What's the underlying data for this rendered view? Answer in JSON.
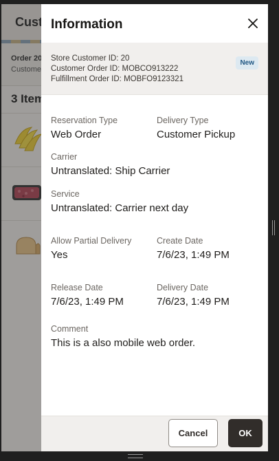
{
  "background": {
    "title": "Cust",
    "order_id": "Order 20",
    "order_sub": "Custome",
    "items_title": "3 Item"
  },
  "drawer": {
    "title": "Information",
    "summary": {
      "store_customer_id": "Store Customer ID: 20",
      "customer_order_id": "Customer Order ID: MOBCO913222",
      "fulfillment_order_id": "Fulfillment Order ID: MOBFO9123321",
      "badge": "New"
    },
    "fields": {
      "reservation_type": {
        "label": "Reservation Type",
        "value": "Web Order"
      },
      "delivery_type": {
        "label": "Delivery Type",
        "value": "Customer Pickup"
      },
      "carrier": {
        "label": "Carrier",
        "value": "Untranslated: Ship Carrier"
      },
      "service": {
        "label": "Service",
        "value": "Untranslated: Carrier next day"
      },
      "allow_partial": {
        "label": "Allow Partial Delivery",
        "value": "Yes"
      },
      "create_date": {
        "label": "Create Date",
        "value": "7/6/23, 1:49 PM"
      },
      "release_date": {
        "label": "Release Date",
        "value": "7/6/23, 1:49 PM"
      },
      "delivery_date": {
        "label": "Delivery Date",
        "value": "7/6/23, 1:49 PM"
      },
      "comment": {
        "label": "Comment",
        "value": "This is a also mobile web order."
      }
    },
    "footer": {
      "cancel_label": "Cancel",
      "ok_label": "OK"
    }
  },
  "colors": {
    "primary_button": "#312d2a",
    "badge_bg": "#dde9f1",
    "badge_text": "#215783"
  }
}
